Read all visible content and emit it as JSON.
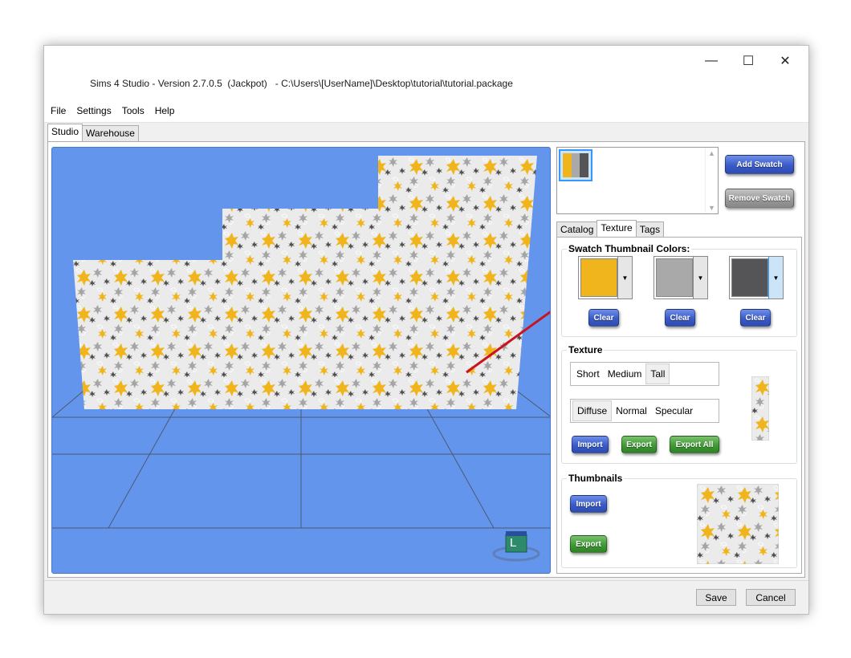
{
  "window": {
    "title": "Sims 4 Studio - Version 2.7.0.5  (Jackpot)   - C:\\Users\\[UserName]\\Desktop\\tutorial\\tutorial.package",
    "minimize_glyph": "—",
    "maximize_glyph": "☐",
    "close_glyph": "✕"
  },
  "menu": {
    "items": [
      {
        "label": "File"
      },
      {
        "label": "Settings"
      },
      {
        "label": "Tools"
      },
      {
        "label": "Help"
      }
    ]
  },
  "main_tabs": [
    {
      "label": "Studio",
      "active": true
    },
    {
      "label": "Warehouse",
      "active": false
    }
  ],
  "viewport": {
    "background": "#6495ed",
    "avatar_letter": "L"
  },
  "swatch_panel": {
    "add_label": "Add Swatch",
    "remove_label": "Remove Swatch",
    "swatch_colors": [
      "#f0b41c",
      "#a9a9a9",
      "#555558"
    ]
  },
  "sub_tabs": [
    {
      "label": "Catalog",
      "active": false
    },
    {
      "label": "Texture",
      "active": true
    },
    {
      "label": "Tags",
      "active": false
    }
  ],
  "thumbnail_colors": {
    "label": "Swatch Thumbnail Colors:",
    "clear_label": "Clear",
    "colors": [
      "#f0b41c",
      "#a9a9a9",
      "#555558"
    ]
  },
  "texture": {
    "label": "Texture",
    "sizes": [
      {
        "label": "Short",
        "selected": false
      },
      {
        "label": "Medium",
        "selected": false
      },
      {
        "label": "Tall",
        "selected": true
      }
    ],
    "maps": [
      {
        "label": "Diffuse",
        "selected": true
      },
      {
        "label": "Normal",
        "selected": false
      },
      {
        "label": "Specular",
        "selected": false
      }
    ],
    "import_label": "Import",
    "export_label": "Export",
    "export_all_label": "Export All"
  },
  "thumbnails": {
    "label": "Thumbnails",
    "import_label": "Import",
    "export_label": "Export"
  },
  "footer": {
    "save_label": "Save",
    "cancel_label": "Cancel"
  },
  "pattern_colors": {
    "base": "#ebebeb",
    "outline": "#ffffff",
    "yellow": "#f0b41c",
    "gray": "#a5a5a5",
    "dark": "#505050"
  },
  "annotation_color": "#c8141e"
}
